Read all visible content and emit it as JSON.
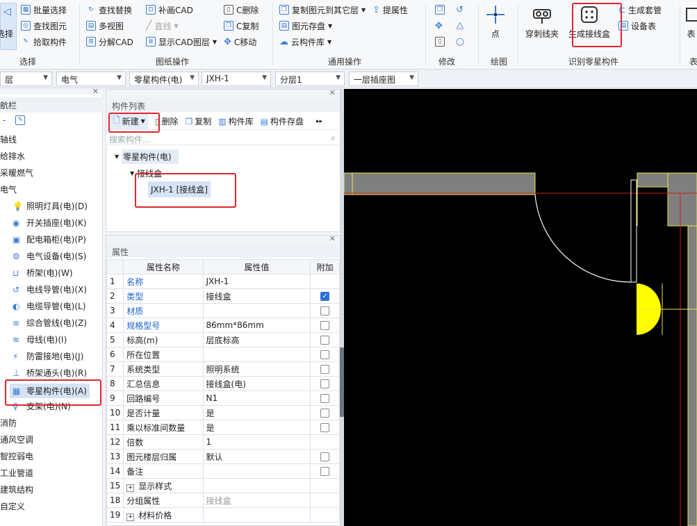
{
  "ribbon": {
    "select_label": "选择",
    "col1": [
      "批量选择",
      "查找图元",
      "拾取构件"
    ],
    "select_group": "选择",
    "col2": [
      "查找替换",
      "多视图",
      "分解CAD"
    ],
    "col3": [
      "补画CAD",
      "直线",
      "显示CAD图层"
    ],
    "col4": [
      "C删除",
      "C复制",
      "C移动"
    ],
    "cad_group": "图纸操作",
    "col5": [
      "复制图元到其它层",
      "图元存盘",
      "云构件库"
    ],
    "tiqushuxing": "提属性",
    "common_group": "通用操作",
    "modify_group": "修改",
    "point_label": "点",
    "draw_group": "绘图",
    "chuanci_label": "穿刺线夹",
    "gen_box_label": "生成接线盒",
    "gen_set_label": "生成套管",
    "device_table_label": "设备表",
    "identify_group": "识别零星构件",
    "biao_label": "表"
  },
  "selectors": [
    "层",
    "电气",
    "零星构件(电)",
    "JXH-1",
    "分层1",
    "一层插座图"
  ],
  "nav": {
    "title": "航栏",
    "items": [
      {
        "label": "轴线",
        "indent": 0
      },
      {
        "label": "给排水",
        "indent": 0
      },
      {
        "label": "采暖燃气",
        "indent": 0
      },
      {
        "label": "电气",
        "indent": 0
      },
      {
        "label": "照明灯具(电)(D)",
        "indent": 1,
        "icon": "bulb-icon"
      },
      {
        "label": "开关插座(电)(K)",
        "indent": 1,
        "icon": "socket-icon"
      },
      {
        "label": "配电箱柜(电)(P)",
        "indent": 1,
        "icon": "cabinet-icon"
      },
      {
        "label": "电气设备(电)(S)",
        "indent": 1,
        "icon": "device-icon"
      },
      {
        "label": "桥架(电)(W)",
        "indent": 1,
        "icon": "tray-icon"
      },
      {
        "label": "电线导管(电)(X)",
        "indent": 1,
        "icon": "wire-icon"
      },
      {
        "label": "电缆导管(电)(L)",
        "indent": 1,
        "icon": "cable-icon"
      },
      {
        "label": "综合管线(电)(Z)",
        "indent": 1,
        "icon": "pipeline-icon"
      },
      {
        "label": "母线(电)(I)",
        "indent": 1,
        "icon": "busbar-icon"
      },
      {
        "label": "防雷接地(电)(J)",
        "indent": 1,
        "icon": "lightning-icon"
      },
      {
        "label": "桥架通头(电)(R)",
        "indent": 1,
        "icon": "tee-icon"
      },
      {
        "label": "零星构件(电)(A)",
        "indent": 1,
        "icon": "grid-icon",
        "selected": true
      },
      {
        "label": "支架(电)(N)",
        "indent": 1,
        "icon": "bracket-icon"
      },
      {
        "label": "消防",
        "indent": 0
      },
      {
        "label": "通风空调",
        "indent": 0
      },
      {
        "label": "智控弱电",
        "indent": 0
      },
      {
        "label": "工业管道",
        "indent": 0
      },
      {
        "label": "建筑结构",
        "indent": 0
      },
      {
        "label": "自定义",
        "indent": 0
      }
    ]
  },
  "component_list": {
    "title": "构件列表",
    "toolbar": [
      "新建",
      "删除",
      "复制",
      "构件库",
      "构件存盘"
    ],
    "search_placeholder": "搜索构件...",
    "tree_root": "零星构件(电)",
    "tree_child": "接线盒",
    "tree_leaf": "JXH-1 [接线盒]"
  },
  "properties": {
    "title": "属性",
    "headers": [
      "属性名称",
      "属性值",
      "附加"
    ],
    "rows": [
      {
        "no": "1",
        "name": "名称",
        "value": "JXH-1",
        "blue": true,
        "check": null
      },
      {
        "no": "2",
        "name": "类型",
        "value": "接线盒",
        "blue": true,
        "check": true
      },
      {
        "no": "3",
        "name": "材质",
        "value": "",
        "blue": true,
        "check": false
      },
      {
        "no": "4",
        "name": "规格型号",
        "value": "86mm*86mm",
        "blue": true,
        "check": false
      },
      {
        "no": "5",
        "name": "标高(m)",
        "value": "层底标高",
        "blue": false,
        "check": false
      },
      {
        "no": "6",
        "name": "所在位置",
        "value": "",
        "blue": false,
        "check": false
      },
      {
        "no": "7",
        "name": "系统类型",
        "value": "照明系统",
        "blue": false,
        "check": false
      },
      {
        "no": "8",
        "name": "汇总信息",
        "value": "接线盒(电)",
        "blue": false,
        "check": false
      },
      {
        "no": "9",
        "name": "回路编号",
        "value": "N1",
        "blue": false,
        "check": false
      },
      {
        "no": "10",
        "name": "是否计量",
        "value": "是",
        "blue": false,
        "check": false
      },
      {
        "no": "11",
        "name": "乘以标准间数量",
        "value": "是",
        "blue": false,
        "check": false
      },
      {
        "no": "12",
        "name": "倍数",
        "value": "1",
        "blue": false,
        "check": null
      },
      {
        "no": "13",
        "name": "图元楼层归属",
        "value": "默认",
        "blue": false,
        "check": false
      },
      {
        "no": "14",
        "name": "备注",
        "value": "",
        "blue": false,
        "check": false
      },
      {
        "no": "15",
        "name": "显示样式",
        "value": "",
        "blue": false,
        "check": null,
        "expand": true
      },
      {
        "no": "18",
        "name": "分组属性",
        "value": "接线盒",
        "blue": false,
        "check": null,
        "grey": true
      },
      {
        "no": "19",
        "name": "材料价格",
        "value": "",
        "blue": false,
        "check": null,
        "expand": true
      }
    ]
  }
}
